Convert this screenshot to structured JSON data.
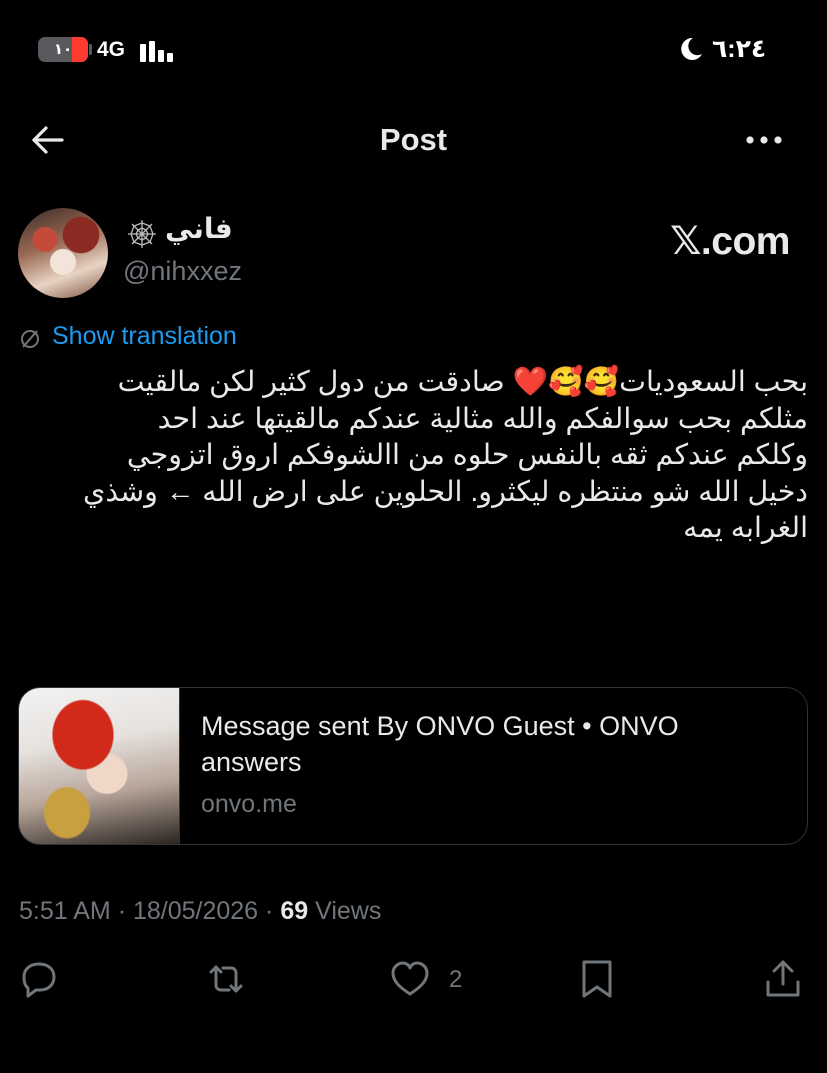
{
  "status_bar": {
    "battery": "١٠",
    "battery_level": 0.1,
    "network": "4G",
    "time": "٦:٢٤",
    "do_not_disturb_icon": "moon-icon"
  },
  "header": {
    "title": "Post",
    "back_icon": "arrow-left-icon",
    "more_icon": "more-horizontal-icon"
  },
  "author": {
    "display_name": "فاني",
    "name_emoji_icon": "spider-web-icon",
    "handle": "@nihxxez"
  },
  "watermark": "𝕏.com",
  "translation": {
    "label": "Show translation"
  },
  "tweet": {
    "text": "بحب السعوديات🥰🥰❤️ صادقت من دول كثير لكن مالقيت\nمثلكم بحب سوالفكم والله مثالية عندكم مالقيتها عند احد\nوكلكم عندكم ثقه  بالنفس حلوه من االشوفكم  اروق  اتزوجي\nدخيل الله شو منتظره ليكثرو. الحلوين على ارض الله ← وشذي\nالغرابه يمه"
  },
  "link_card": {
    "title": "Message sent By ONVO Guest • ONVO answers",
    "domain": "onvo.me"
  },
  "meta": {
    "time": "5:51 AM",
    "separator": "·",
    "date": "18/05/2026",
    "views_count": "69",
    "views_label": "Views"
  },
  "actions": {
    "reply_icon": "reply-icon",
    "repost_icon": "repost-icon",
    "like_icon": "heart-icon",
    "like_count": "2",
    "bookmark_icon": "bookmark-icon",
    "share_icon": "share-icon"
  }
}
